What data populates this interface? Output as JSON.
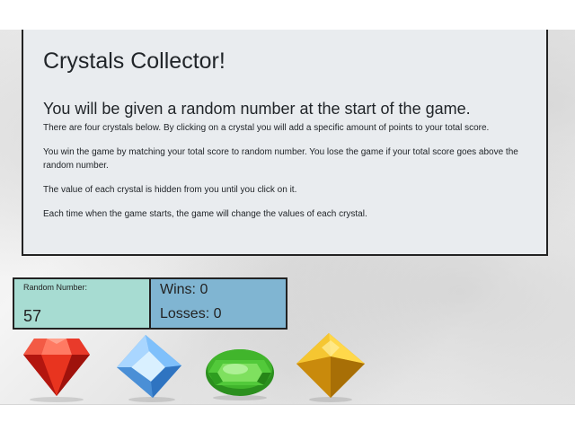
{
  "jumbotron": {
    "title": "Crystals Collector!",
    "subtitle": "You will be given a random number at the start of the game.",
    "paragraphs": [
      "There are four crystals below. By clicking on a crystal you will add a specific amount of points to your total score.",
      "You win the game by matching your total score to random number. You lose the game if your total score goes above the random number.",
      "The value of each crystal is hidden from you until you click on it.",
      "Each time when the game starts, the game will change the values of each crystal."
    ]
  },
  "random": {
    "label": "Random Number:",
    "value": "57"
  },
  "stats": {
    "wins": "Wins: 0",
    "losses": "Losses: 0"
  },
  "crystals": [
    {
      "name": "red-crystal-icon",
      "color": "#e0241c"
    },
    {
      "name": "blue-crystal-icon",
      "color": "#6fb4ee"
    },
    {
      "name": "green-crystal-icon",
      "color": "#3cae2a"
    },
    {
      "name": "yellow-crystal-icon",
      "color": "#e3ab17"
    }
  ]
}
